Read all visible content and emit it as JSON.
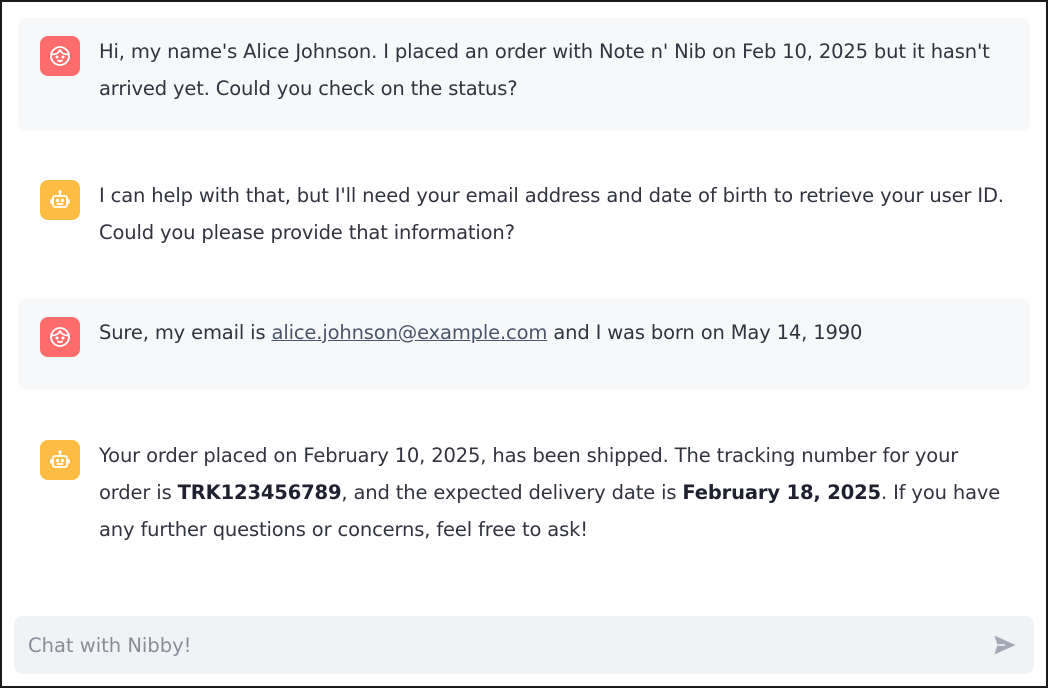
{
  "messages": [
    {
      "role": "user",
      "icon": "user-face-icon",
      "text": "Hi, my name's Alice Johnson. I placed an order with Note n' Nib on Feb 10, 2025 but it hasn't arrived yet. Could you check on the status?"
    },
    {
      "role": "assistant",
      "icon": "robot-icon",
      "text": "I can help with that, but I'll need your email address and date of birth to retrieve your user ID. Could you please provide that information?"
    },
    {
      "role": "user",
      "icon": "user-face-icon",
      "text_before": "Sure, my email is ",
      "link": "alice.johnson@example.com",
      "text_after": " and I was born on May 14, 1990"
    },
    {
      "role": "assistant",
      "icon": "robot-icon",
      "text_1": "Your order placed on February 10, 2025, has been shipped. The tracking number for your order is ",
      "tracking": "TRK123456789",
      "text_2": ", and the expected delivery date is ",
      "delivery_date": "February 18, 2025",
      "text_3": ". If you have any further questions or concerns, feel free to ask!"
    }
  ],
  "chat_input": {
    "placeholder": "Chat with Nibby!",
    "value": "",
    "send_icon": "send-icon"
  },
  "colors": {
    "user_avatar": "#ff6c6c",
    "assistant_avatar": "#ffbd45",
    "user_bubble": "#f7f8fa",
    "input_background": "#f0f2f6"
  }
}
